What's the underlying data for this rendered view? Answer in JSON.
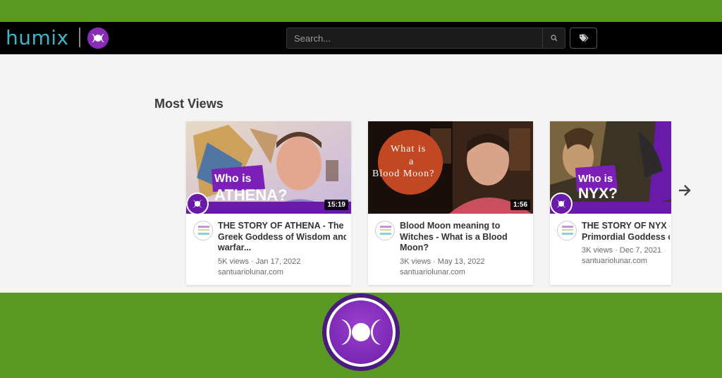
{
  "header": {
    "logo_text": "humix",
    "search_placeholder": "Search..."
  },
  "section": {
    "title": "Most Views"
  },
  "videos": [
    {
      "thumb_line1": "Who is",
      "thumb_line2": "ATHENA?",
      "duration": "15:19",
      "title": "THE STORY OF ATHENA - The\nGreek Goddess of Wisdom and\nwarfar...",
      "meta": "5K views · Jan 17, 2022",
      "channel": "santuariolunar.com"
    },
    {
      "thumb_line1": "What is",
      "thumb_line2": "a",
      "thumb_line3": "Blood Moon?",
      "duration": "1:56",
      "title": "Blood Moon meaning to\nWitches - What is a Blood\nMoon?",
      "meta": "3K views · May 13, 2022",
      "channel": "santuariolunar.com"
    },
    {
      "thumb_line1": "Who is",
      "thumb_line2": "NYX?",
      "title": "THE STORY OF NYX - G\nPrimordial Goddess of",
      "meta": "3K views · Dec 7, 2021",
      "channel": "santuariolunar.com"
    }
  ],
  "colors": {
    "brand_green": "#5a9a24",
    "brand_purple": "#8a2db6",
    "logo_teal": "#3fb4c4"
  }
}
